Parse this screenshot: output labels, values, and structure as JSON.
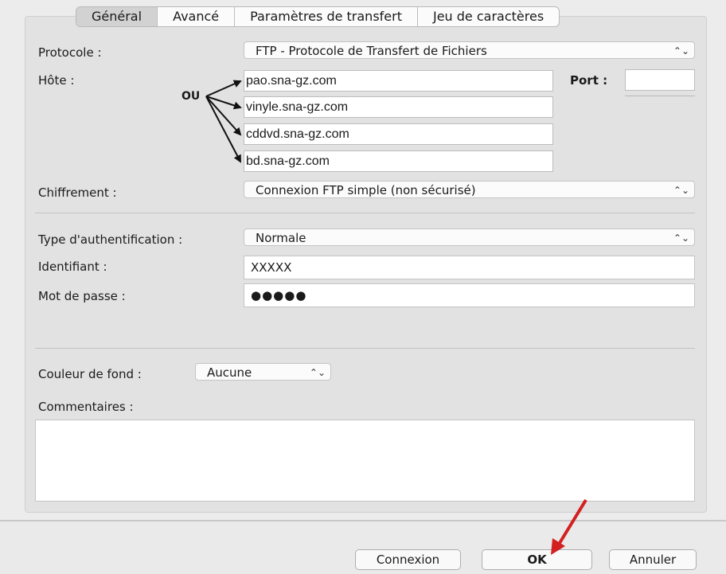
{
  "tabs": [
    {
      "label": "Général",
      "active": true
    },
    {
      "label": "Avancé",
      "active": false
    },
    {
      "label": "Paramètres de transfert",
      "active": false
    },
    {
      "label": "Jeu de caractères",
      "active": false
    }
  ],
  "protocol": {
    "label": "Protocole :",
    "value": "FTP - Protocole de Transfert de Fichiers"
  },
  "host": {
    "label": "Hôte :",
    "annotation": "OU",
    "options": [
      "pao.sna-gz.com",
      "vinyle.sna-gz.com",
      "cddvd.sna-gz.com",
      "bd.sna-gz.com"
    ]
  },
  "port": {
    "label": "Port :",
    "value": ""
  },
  "encryption": {
    "label": "Chiffrement :",
    "value": "Connexion FTP simple (non sécurisé)"
  },
  "auth": {
    "label": "Type d'authentification :",
    "value": "Normale"
  },
  "login": {
    "label": "Identifiant :",
    "value": "XXXXX"
  },
  "password": {
    "label": "Mot de passe :",
    "value": "●●●●●"
  },
  "background": {
    "label": "Couleur de fond :",
    "value": "Aucune"
  },
  "comments": {
    "label": "Commentaires :",
    "value": ""
  },
  "buttons": {
    "connect": "Connexion",
    "ok": "OK",
    "cancel": "Annuler"
  },
  "annotation_color": "#d32020"
}
